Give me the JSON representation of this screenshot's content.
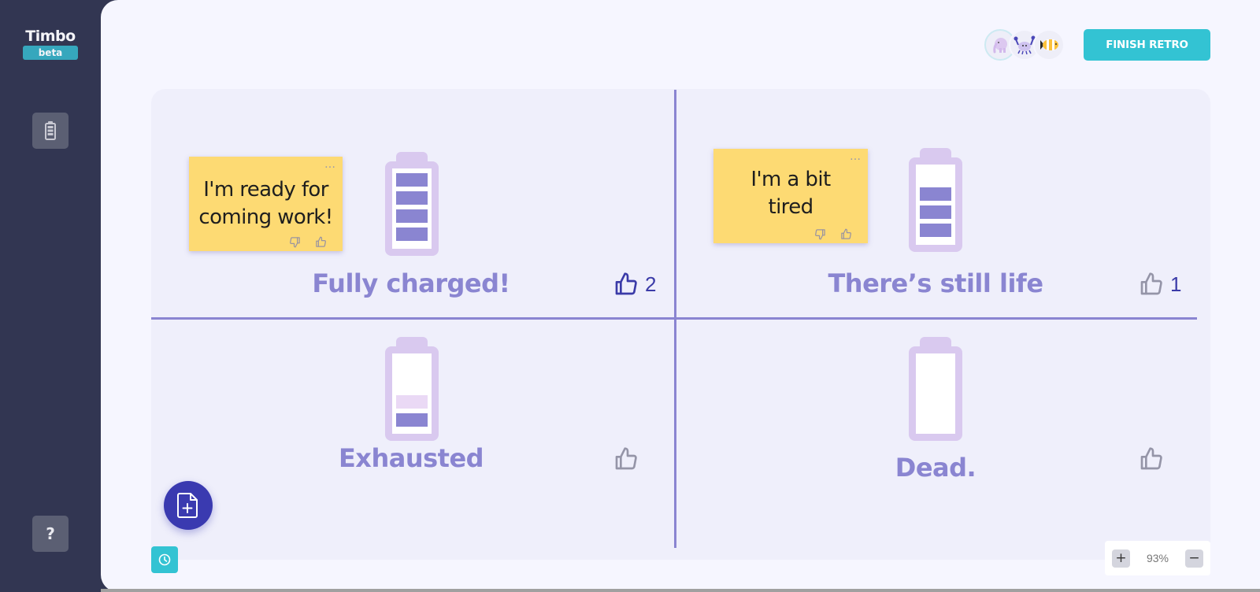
{
  "app": {
    "name": "Timbo",
    "badge": "beta"
  },
  "sidebar": {
    "items": [
      {
        "icon": "battery-icon",
        "label": "Battery retro"
      },
      {
        "icon": "help-icon",
        "label": "?"
      }
    ]
  },
  "header": {
    "participants": [
      {
        "avatar": "elephant-avatar"
      },
      {
        "avatar": "crab-avatar"
      },
      {
        "avatar": "clownfish-avatar"
      }
    ],
    "finish_label": "FINISH RETRO"
  },
  "board": {
    "quadrants": [
      {
        "title": "Fully charged!",
        "battery_level": 4,
        "votes": "2",
        "voted": true
      },
      {
        "title": "There’s still life",
        "battery_level": 3,
        "votes": "1",
        "voted": false
      },
      {
        "title": "Exhausted",
        "battery_level": 1,
        "votes": "",
        "voted": false
      },
      {
        "title": "Dead.",
        "battery_level": 0,
        "votes": "",
        "voted": false
      }
    ],
    "stickies": [
      {
        "text_line1": "I'm ready for",
        "text_line2": "coming work!",
        "quadrant": "Fully charged!"
      },
      {
        "text_line1": "I'm a bit",
        "text_line2": "tired",
        "quadrant": "There’s still life"
      }
    ],
    "menu_glyph": "…"
  },
  "zoom": {
    "value": "93%",
    "plus": "+",
    "minus": "−"
  },
  "colors": {
    "accent": "#33c3d3",
    "primary": "#3a3ab0",
    "quadrant_text": "#8a85d1",
    "sticky": "#fdda73",
    "sidebar": "#323652"
  }
}
